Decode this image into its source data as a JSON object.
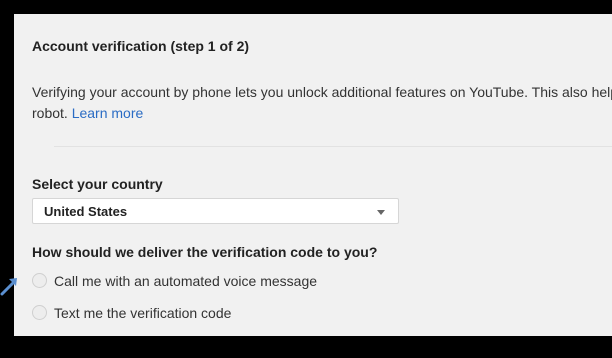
{
  "dialog": {
    "title": "Account verification (step 1 of 2)",
    "description_line1": "Verifying your account by phone lets you unlock additional features on YouTube. This also helps us verify you're not a",
    "description_line2_prefix": "robot.",
    "learn_more": "Learn more"
  },
  "country": {
    "label": "Select your country",
    "selected": "United States"
  },
  "delivery": {
    "question": "How should we deliver the verification code to you?",
    "options": [
      "Call me with an automated voice message",
      "Text me the verification code"
    ]
  },
  "colors": {
    "link": "#2a6cc4",
    "panel_background": "#f1f1f1",
    "frame": "#000000",
    "annotation_arrow": "#5b8fd0"
  },
  "icons": {
    "annotation": "arrow-pointer-icon",
    "dropdown": "chevron-down-icon"
  }
}
